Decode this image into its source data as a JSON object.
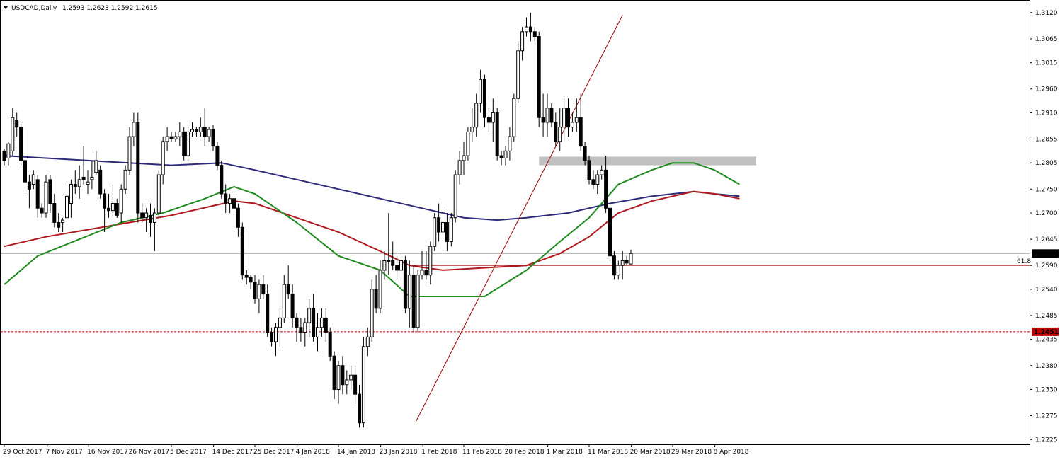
{
  "header": {
    "symbol": "USDCAD,Daily",
    "ohlc": "1.2593 1.2623 1.2592 1.2615"
  },
  "chart_data": {
    "type": "candlestick",
    "symbol": "USDCAD",
    "timeframe": "Daily",
    "ylim": [
      1.2215,
      1.3145
    ],
    "y_ticks": [
      "1.3120",
      "1.3065",
      "1.3015",
      "1.2960",
      "1.2910",
      "1.2855",
      "1.2805",
      "1.2750",
      "1.2700",
      "1.2645",
      "1.2590",
      "1.2540",
      "1.2485",
      "1.2435",
      "1.2380",
      "1.2330",
      "1.2275",
      "1.2225"
    ],
    "x_ticks": [
      {
        "label": "29 Oct 2017",
        "index": 0
      },
      {
        "label": "7 Nov 2017",
        "index": 10.3
      },
      {
        "label": "16 Nov 2017",
        "index": 20.2
      },
      {
        "label": "26 Nov 2017",
        "index": 30.1
      },
      {
        "label": "5 Dec 2017",
        "index": 40
      },
      {
        "label": "14 Dec 2017",
        "index": 50.1
      },
      {
        "label": "25 Dec 2017",
        "index": 60
      },
      {
        "label": "4 Jan 2018",
        "index": 70.1
      },
      {
        "label": "14 Jan 2018",
        "index": 80
      },
      {
        "label": "23 Jan 2018",
        "index": 90.1
      },
      {
        "label": "1 Feb 2018",
        "index": 100.2
      },
      {
        "label": "11 Feb 2018",
        "index": 110
      },
      {
        "label": "20 Feb 2018",
        "index": 120.1
      },
      {
        "label": "1 Mar 2018",
        "index": 130.1
      },
      {
        "label": "11 Mar 2018",
        "index": 140
      },
      {
        "label": "20 Mar 2018",
        "index": 150.1
      },
      {
        "label": "29 Mar 2018",
        "index": 160
      },
      {
        "label": "8 Apr 2018",
        "index": 170.1
      }
    ],
    "candles": [
      [
        1.283,
        1.2835,
        1.28,
        1.281
      ],
      [
        1.2815,
        1.285,
        1.28,
        1.2845
      ],
      [
        1.283,
        1.292,
        1.282,
        1.29
      ],
      [
        1.2895,
        1.291,
        1.286,
        1.288
      ],
      [
        1.288,
        1.289,
        1.28,
        1.281
      ],
      [
        1.281,
        1.282,
        1.274,
        1.2765
      ],
      [
        1.2765,
        1.278,
        1.271,
        1.275
      ],
      [
        1.276,
        1.279,
        1.275,
        1.278
      ],
      [
        1.277,
        1.278,
        1.269,
        1.271
      ],
      [
        1.271,
        1.272,
        1.269,
        1.27
      ],
      [
        1.27,
        1.278,
        1.269,
        1.2765
      ],
      [
        1.277,
        1.278,
        1.27,
        1.272
      ],
      [
        1.272,
        1.274,
        1.267,
        1.268
      ],
      [
        1.268,
        1.27,
        1.266,
        1.267
      ],
      [
        1.268,
        1.269,
        1.266,
        1.2685
      ],
      [
        1.269,
        1.276,
        1.268,
        1.2735
      ],
      [
        1.272,
        1.277,
        1.269,
        1.276
      ],
      [
        1.276,
        1.279,
        1.274,
        1.2755
      ],
      [
        1.2755,
        1.28,
        1.273,
        1.277
      ],
      [
        1.2775,
        1.284,
        1.276,
        1.277
      ],
      [
        1.276,
        1.279,
        1.274,
        1.2765
      ],
      [
        1.277,
        1.281,
        1.275,
        1.2775
      ],
      [
        1.2785,
        1.283,
        1.278,
        1.281
      ],
      [
        1.279,
        1.28,
        1.273,
        1.274
      ],
      [
        1.274,
        1.275,
        1.266,
        1.271
      ],
      [
        1.271,
        1.274,
        1.269,
        1.2705
      ],
      [
        1.2705,
        1.276,
        1.269,
        1.272
      ],
      [
        1.272,
        1.273,
        1.269,
        1.2695
      ],
      [
        1.27,
        1.276,
        1.268,
        1.275
      ],
      [
        1.275,
        1.28,
        1.274,
        1.279
      ],
      [
        1.279,
        1.288,
        1.278,
        1.286
      ],
      [
        1.286,
        1.291,
        1.284,
        1.289
      ],
      [
        1.289,
        1.291,
        1.268,
        1.27
      ],
      [
        1.27,
        1.272,
        1.268,
        1.269
      ],
      [
        1.269,
        1.271,
        1.266,
        1.27
      ],
      [
        1.2695,
        1.272,
        1.265,
        1.268
      ],
      [
        1.268,
        1.271,
        1.262,
        1.27
      ],
      [
        1.27,
        1.279,
        1.269,
        1.278
      ],
      [
        1.278,
        1.286,
        1.276,
        1.285
      ],
      [
        1.285,
        1.288,
        1.283,
        1.286
      ],
      [
        1.286,
        1.287,
        1.285,
        1.2855
      ],
      [
        1.2855,
        1.287,
        1.285,
        1.286
      ],
      [
        1.286,
        1.289,
        1.284,
        1.287
      ],
      [
        1.287,
        1.288,
        1.281,
        1.282
      ],
      [
        1.282,
        1.288,
        1.281,
        1.287
      ],
      [
        1.287,
        1.289,
        1.286,
        1.2875
      ],
      [
        1.2875,
        1.288,
        1.286,
        1.287
      ],
      [
        1.287,
        1.29,
        1.286,
        1.288
      ],
      [
        1.288,
        1.292,
        1.284,
        1.286
      ],
      [
        1.286,
        1.288,
        1.285,
        1.2875
      ],
      [
        1.2875,
        1.2885,
        1.283,
        1.284
      ],
      [
        1.284,
        1.285,
        1.279,
        1.28
      ],
      [
        1.28,
        1.281,
        1.273,
        1.274
      ],
      [
        1.274,
        1.276,
        1.27,
        1.272
      ],
      [
        1.272,
        1.274,
        1.27,
        1.273
      ],
      [
        1.273,
        1.274,
        1.27,
        1.271
      ],
      [
        1.271,
        1.272,
        1.265,
        1.267
      ],
      [
        1.267,
        1.268,
        1.256,
        1.257
      ],
      [
        1.257,
        1.258,
        1.255,
        1.2565
      ],
      [
        1.2565,
        1.257,
        1.254,
        1.2555
      ],
      [
        1.2555,
        1.257,
        1.251,
        1.252
      ],
      [
        1.252,
        1.256,
        1.249,
        1.255
      ],
      [
        1.255,
        1.257,
        1.252,
        1.253
      ],
      [
        1.253,
        1.255,
        1.244,
        1.245
      ],
      [
        1.245,
        1.246,
        1.242,
        1.243
      ],
      [
        1.243,
        1.247,
        1.24,
        1.246
      ],
      [
        1.246,
        1.25,
        1.242,
        1.248
      ],
      [
        1.248,
        1.257,
        1.247,
        1.255
      ],
      [
        1.255,
        1.259,
        1.252,
        1.253
      ],
      [
        1.253,
        1.255,
        1.246,
        1.248
      ],
      [
        1.248,
        1.249,
        1.243,
        1.246
      ],
      [
        1.246,
        1.248,
        1.243,
        1.245
      ],
      [
        1.245,
        1.248,
        1.242,
        1.247
      ],
      [
        1.247,
        1.252,
        1.244,
        1.25
      ],
      [
        1.25,
        1.253,
        1.243,
        1.244
      ],
      [
        1.244,
        1.249,
        1.241,
        1.246
      ],
      [
        1.246,
        1.25,
        1.244,
        1.248
      ],
      [
        1.248,
        1.25,
        1.243,
        1.245
      ],
      [
        1.245,
        1.246,
        1.239,
        1.24
      ],
      [
        1.24,
        1.241,
        1.231,
        1.233
      ],
      [
        1.233,
        1.239,
        1.23,
        1.238
      ],
      [
        1.238,
        1.24,
        1.232,
        1.234
      ],
      [
        1.234,
        1.237,
        1.232,
        1.235
      ],
      [
        1.235,
        1.238,
        1.233,
        1.236
      ],
      [
        1.236,
        1.238,
        1.23,
        1.232
      ],
      [
        1.232,
        1.234,
        1.225,
        1.226
      ],
      [
        1.226,
        1.244,
        1.225,
        1.242
      ],
      [
        1.242,
        1.246,
        1.24,
        1.244
      ],
      [
        1.244,
        1.256,
        1.243,
        1.254
      ],
      [
        1.254,
        1.257,
        1.249,
        1.25
      ],
      [
        1.25,
        1.26,
        1.249,
        1.258
      ],
      [
        1.258,
        1.262,
        1.256,
        1.26
      ],
      [
        1.26,
        1.27,
        1.257,
        1.26
      ],
      [
        1.26,
        1.264,
        1.258,
        1.259
      ],
      [
        1.259,
        1.261,
        1.256,
        1.258
      ],
      [
        1.258,
        1.262,
        1.255,
        1.26
      ],
      [
        1.26,
        1.261,
        1.249,
        1.25
      ],
      [
        1.25,
        1.26,
        1.246,
        1.257
      ],
      [
        1.257,
        1.259,
        1.245,
        1.246
      ],
      [
        1.246,
        1.258,
        1.245,
        1.257
      ],
      [
        1.257,
        1.262,
        1.256,
        1.258
      ],
      [
        1.258,
        1.262,
        1.256,
        1.257
      ],
      [
        1.257,
        1.264,
        1.255,
        1.263
      ],
      [
        1.263,
        1.27,
        1.262,
        1.269
      ],
      [
        1.269,
        1.272,
        1.264,
        1.266
      ],
      [
        1.266,
        1.271,
        1.264,
        1.268
      ],
      [
        1.268,
        1.27,
        1.262,
        1.264
      ],
      [
        1.264,
        1.27,
        1.263,
        1.269
      ],
      [
        1.269,
        1.279,
        1.268,
        1.278
      ],
      [
        1.278,
        1.283,
        1.276,
        1.281
      ],
      [
        1.281,
        1.285,
        1.278,
        1.282
      ],
      [
        1.282,
        1.288,
        1.281,
        1.287
      ],
      [
        1.287,
        1.292,
        1.285,
        1.288
      ],
      [
        1.288,
        1.295,
        1.286,
        1.293
      ],
      [
        1.293,
        1.3,
        1.291,
        1.298
      ],
      [
        1.298,
        1.299,
        1.288,
        1.29
      ],
      [
        1.29,
        1.292,
        1.287,
        1.289
      ],
      [
        1.289,
        1.294,
        1.285,
        1.291
      ],
      [
        1.291,
        1.292,
        1.281,
        1.282
      ],
      [
        1.282,
        1.283,
        1.28,
        1.2815
      ],
      [
        1.2815,
        1.284,
        1.28,
        1.283
      ],
      [
        1.283,
        1.288,
        1.281,
        1.286
      ],
      [
        1.286,
        1.295,
        1.285,
        1.294
      ],
      [
        1.294,
        1.306,
        1.293,
        1.304
      ],
      [
        1.304,
        1.309,
        1.302,
        1.308
      ],
      [
        1.308,
        1.311,
        1.307,
        1.309
      ],
      [
        1.309,
        1.312,
        1.306,
        1.308
      ],
      [
        1.308,
        1.309,
        1.306,
        1.307
      ],
      [
        1.307,
        1.308,
        1.288,
        1.29
      ],
      [
        1.29,
        1.295,
        1.286,
        1.289
      ],
      [
        1.289,
        1.295,
        1.286,
        1.292
      ],
      [
        1.292,
        1.293,
        1.288,
        1.289
      ],
      [
        1.289,
        1.291,
        1.284,
        1.285
      ],
      [
        1.285,
        1.292,
        1.283,
        1.288
      ],
      [
        1.288,
        1.294,
        1.285,
        1.292
      ],
      [
        1.292,
        1.294,
        1.286,
        1.288
      ],
      [
        1.288,
        1.291,
        1.287,
        1.289
      ],
      [
        1.289,
        1.294,
        1.287,
        1.29
      ],
      [
        1.29,
        1.295,
        1.283,
        1.284
      ],
      [
        1.284,
        1.285,
        1.28,
        1.281
      ],
      [
        1.281,
        1.282,
        1.276,
        1.277
      ],
      [
        1.277,
        1.279,
        1.275,
        1.276
      ],
      [
        1.276,
        1.279,
        1.274,
        1.278
      ],
      [
        1.278,
        1.28,
        1.277,
        1.279
      ],
      [
        1.279,
        1.282,
        1.27,
        1.271
      ],
      [
        1.271,
        1.272,
        1.26,
        1.261
      ],
      [
        1.261,
        1.262,
        1.256,
        1.257
      ],
      [
        1.257,
        1.26,
        1.256,
        1.259
      ],
      [
        1.259,
        1.262,
        1.256,
        1.26
      ],
      [
        1.26,
        1.261,
        1.259,
        1.2595
      ],
      [
        1.2593,
        1.2623,
        1.2592,
        1.2615
      ]
    ],
    "moving_averages": [
      {
        "color": "#2e2a7a",
        "points": [
          [
            0,
            1.282
          ],
          [
            20,
            1.281
          ],
          [
            40,
            1.28
          ],
          [
            52,
            1.2805
          ],
          [
            60,
            1.279
          ],
          [
            70,
            1.277
          ],
          [
            80,
            1.275
          ],
          [
            90,
            1.273
          ],
          [
            100,
            1.271
          ],
          [
            110,
            1.269
          ],
          [
            118,
            1.2685
          ],
          [
            125,
            1.269
          ],
          [
            135,
            1.27
          ],
          [
            145,
            1.272
          ],
          [
            155,
            1.2735
          ],
          [
            165,
            1.2745
          ],
          [
            170,
            1.274
          ],
          [
            176,
            1.2735
          ]
        ]
      },
      {
        "color": "#b0191e",
        "points": [
          [
            0,
            1.263
          ],
          [
            10,
            1.265
          ],
          [
            20,
            1.2665
          ],
          [
            30,
            1.268
          ],
          [
            40,
            1.2695
          ],
          [
            50,
            1.2715
          ],
          [
            55,
            1.2725
          ],
          [
            60,
            1.272
          ],
          [
            70,
            1.269
          ],
          [
            80,
            1.266
          ],
          [
            90,
            1.262
          ],
          [
            97,
            1.259
          ],
          [
            105,
            1.258
          ],
          [
            115,
            1.2585
          ],
          [
            125,
            1.259
          ],
          [
            133,
            1.2615
          ],
          [
            140,
            1.265
          ],
          [
            147,
            1.27
          ],
          [
            155,
            1.2725
          ],
          [
            165,
            1.2745
          ],
          [
            170,
            1.274
          ],
          [
            176,
            1.273
          ]
        ]
      },
      {
        "color": "#1e8a1e",
        "points": [
          [
            0,
            1.255
          ],
          [
            8,
            1.261
          ],
          [
            18,
            1.2645
          ],
          [
            28,
            1.268
          ],
          [
            38,
            1.27
          ],
          [
            48,
            1.273
          ],
          [
            55,
            1.2755
          ],
          [
            60,
            1.274
          ],
          [
            70,
            1.268
          ],
          [
            80,
            1.261
          ],
          [
            90,
            1.258
          ],
          [
            97,
            1.2525
          ],
          [
            105,
            1.2525
          ],
          [
            115,
            1.2525
          ],
          [
            125,
            1.258
          ],
          [
            133,
            1.264
          ],
          [
            140,
            1.269
          ],
          [
            147,
            1.276
          ],
          [
            155,
            1.279
          ],
          [
            160,
            1.2805
          ],
          [
            165,
            1.2805
          ],
          [
            170,
            1.279
          ],
          [
            176,
            1.276
          ]
        ]
      }
    ],
    "trend_line": {
      "color": "#a00000",
      "from": [
        98.5,
        1.2262
      ],
      "to": [
        148,
        1.3115
      ]
    },
    "resistance_zone": {
      "y_low": 1.28,
      "y_high": 1.2818,
      "x_from": 128,
      "x_to": 180
    },
    "fib_level": {
      "value": 1.259,
      "label": "61.8",
      "color": "#a00000",
      "x_from": 97
    },
    "current_price": {
      "value": 1.2615,
      "label": "1.2615"
    },
    "alert_level": {
      "value": 1.2451,
      "label": "1.2451",
      "color": "#c00000"
    }
  }
}
